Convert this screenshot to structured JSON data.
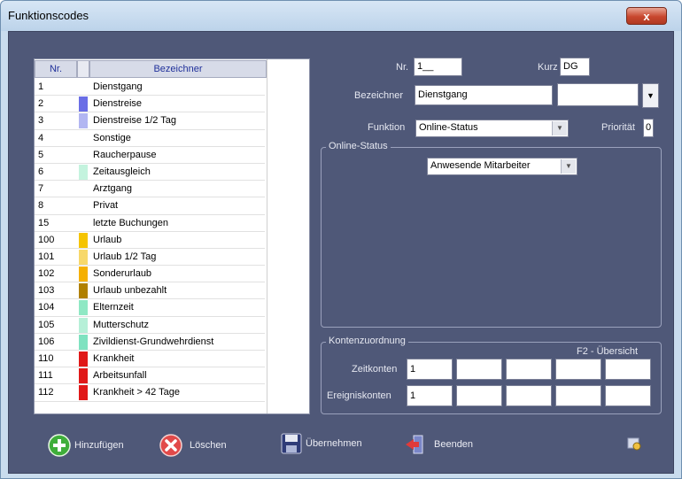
{
  "window": {
    "title": "Funktionscodes",
    "close_label": "x"
  },
  "list": {
    "header": {
      "nr": "Nr.",
      "name": "Bezeichner"
    },
    "rows": [
      {
        "nr": "1",
        "name": "Dienstgang",
        "color": ""
      },
      {
        "nr": "2",
        "name": "Dienstreise",
        "color": "#6a6ee6"
      },
      {
        "nr": "3",
        "name": "Dienstreise 1/2 Tag",
        "color": "#b2b6f2"
      },
      {
        "nr": "4",
        "name": "Sonstige",
        "color": ""
      },
      {
        "nr": "5",
        "name": "Raucherpause",
        "color": ""
      },
      {
        "nr": "6",
        "name": "Zeitausgleich",
        "color": "#c4f3de"
      },
      {
        "nr": "7",
        "name": "Arztgang",
        "color": ""
      },
      {
        "nr": "8",
        "name": "Privat",
        "color": ""
      },
      {
        "nr": "15",
        "name": "letzte Buchungen",
        "color": ""
      },
      {
        "nr": "100",
        "name": "Urlaub",
        "color": "#f5c400"
      },
      {
        "nr": "101",
        "name": "Urlaub 1/2 Tag",
        "color": "#f7d86a"
      },
      {
        "nr": "102",
        "name": "Sonderurlaub",
        "color": "#f5b000"
      },
      {
        "nr": "103",
        "name": "Urlaub unbezahlt",
        "color": "#b08000"
      },
      {
        "nr": "104",
        "name": "Elternzeit",
        "color": "#8fe8c4"
      },
      {
        "nr": "105",
        "name": "Mutterschutz",
        "color": "#b6f0d8"
      },
      {
        "nr": "106",
        "name": "Zivildienst-Grundwehrdienst",
        "color": "#7fe2c0"
      },
      {
        "nr": "110",
        "name": "Krankheit",
        "color": "#e01818"
      },
      {
        "nr": "111",
        "name": "Arbeitsunfall",
        "color": "#e01818"
      },
      {
        "nr": "112",
        "name": "Krankheit > 42 Tage",
        "color": "#e01818"
      }
    ]
  },
  "form": {
    "nr_label": "Nr.",
    "nr_value": "1__",
    "kurz_label": "Kurz",
    "kurz_value": "DG",
    "bez_label": "Bezeichner",
    "bez_value": "Dienstgang",
    "color_value": "",
    "funktion_label": "Funktion",
    "funktion_value": "Online-Status",
    "prioritaet_label": "Priorität",
    "prioritaet_value": "0"
  },
  "online_status": {
    "title": "Online-Status",
    "select_value": "Anwesende Mitarbeiter"
  },
  "konten": {
    "title": "Kontenzuordnung",
    "f2_label": "F2 - Übersicht",
    "zeit_label": "Zeitkonten",
    "zeit_values": [
      "1",
      "",
      "",
      "",
      ""
    ],
    "ereignis_label": "Ereigniskonten",
    "ereignis_values": [
      "1",
      "",
      "",
      "",
      ""
    ]
  },
  "buttons": {
    "add": "Hinzufügen",
    "delete": "Löschen",
    "save": "Übernehmen",
    "exit": "Beenden"
  },
  "colors": {
    "client_bg": "#4f5878",
    "accent_header": "#20309a"
  }
}
